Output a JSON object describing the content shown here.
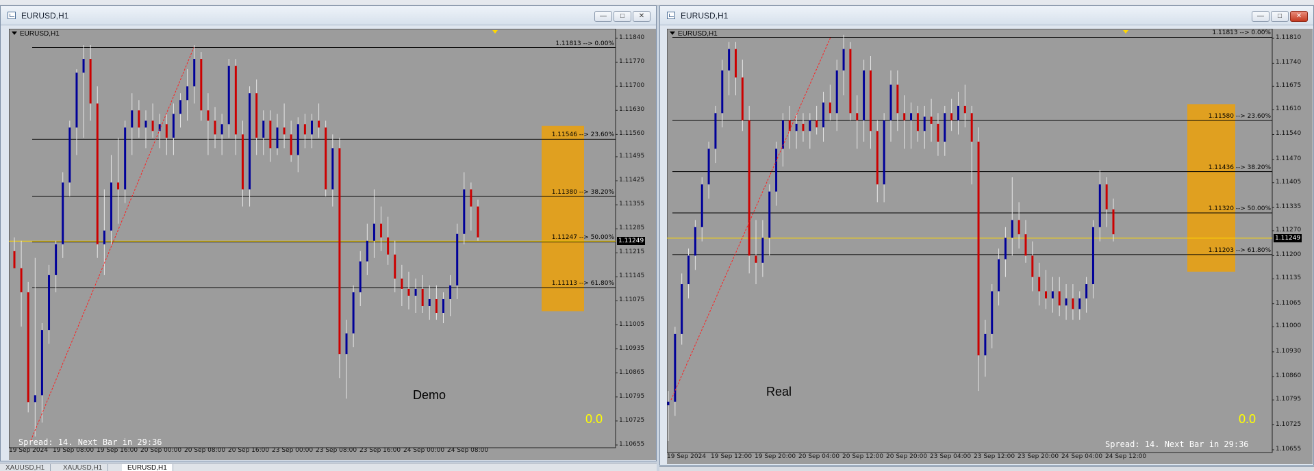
{
  "left_window": {
    "title": "EURUSD,H1",
    "chart_label": "EURUSD,H1",
    "annotation": "Demo",
    "signal_value": "0.0",
    "status": "Spread: 14. Next Bar in 29:36",
    "current_price": "1.11249",
    "y_axis": {
      "min": 1.10655,
      "max": 1.1184,
      "ticks": [
        "1.11840",
        "1.11770",
        "1.11700",
        "1.11630",
        "1.11560",
        "1.11495",
        "1.11425",
        "1.11355",
        "1.11285",
        "1.11215",
        "1.11145",
        "1.11075",
        "1.11005",
        "1.10935",
        "1.10865",
        "1.10795",
        "1.10725",
        "1.10655"
      ]
    },
    "x_axis": [
      "19 Sep 2024",
      "19 Sep 08:00",
      "19 Sep 16:00",
      "20 Sep 00:00",
      "20 Sep 08:00",
      "20 Sep 16:00",
      "23 Sep 00:00",
      "23 Sep 08:00",
      "23 Sep 16:00",
      "24 Sep 00:00",
      "24 Sep 08:00"
    ],
    "fib_levels": [
      {
        "price": 1.11813,
        "label": "1.11813 --> 0.00%"
      },
      {
        "price": 1.11546,
        "label": "1.11546 --> 23.60%"
      },
      {
        "price": 1.1138,
        "label": "1.11380 --> 38.20%"
      },
      {
        "price": 1.11247,
        "label": "1.11247 --> 50.00%"
      },
      {
        "price": 1.11113,
        "label": "1.11113 --> 61.80%"
      }
    ],
    "zone": {
      "top_price": 1.11585,
      "bottom_price": 1.11045
    },
    "trend_line": {
      "from_price": 1.10668,
      "to_price": 1.11813
    }
  },
  "right_window": {
    "title": "EURUSD,H1",
    "chart_label": "EURUSD,H1",
    "annotation": "Real",
    "signal_value": "0.0",
    "status": "Spread: 14. Next Bar in 29:36",
    "current_price": "1.11249",
    "y_axis": {
      "min": 1.10655,
      "max": 1.1181,
      "ticks": [
        "1.11810",
        "1.11740",
        "1.11675",
        "1.11610",
        "1.11540",
        "1.11470",
        "1.11405",
        "1.11335",
        "1.11270",
        "1.11200",
        "1.11135",
        "1.11065",
        "1.11000",
        "1.10930",
        "1.10860",
        "1.10795",
        "1.10725",
        "1.10655"
      ]
    },
    "x_axis": [
      "19 Sep 2024",
      "19 Sep 12:00",
      "19 Sep 20:00",
      "20 Sep 04:00",
      "20 Sep 12:00",
      "20 Sep 20:00",
      "23 Sep 04:00",
      "23 Sep 12:00",
      "23 Sep 20:00",
      "24 Sep 04:00",
      "24 Sep 12:00"
    ],
    "fib_levels": [
      {
        "price": 1.11813,
        "label": "1.11813 --> 0.00%"
      },
      {
        "price": 1.1158,
        "label": "1.11580 --> 23.60%"
      },
      {
        "price": 1.11436,
        "label": "1.11436 --> 38.20%"
      },
      {
        "price": 1.1132,
        "label": "1.11320 --> 50.00%"
      },
      {
        "price": 1.11203,
        "label": "1.11203 --> 61.80%"
      }
    ],
    "zone": {
      "top_price": 1.11625,
      "bottom_price": 1.11155
    },
    "trend_line": {
      "from_price": 1.10795,
      "to_price": 1.11813
    }
  },
  "bottom_tabs": [
    "XAUUSD,H1",
    "XAUUSD,H1",
    "EURUSD,H1"
  ],
  "colors": {
    "chart_bg": "#9c9c9c",
    "bull": "#000099",
    "bear": "#cc0000",
    "doji": "#22bb22",
    "fib_line": "#000000",
    "current_price_line": "#ffd700",
    "zone": "#e0a020",
    "signal": "#ffff00",
    "trend_line": "#ff2020"
  },
  "chart_data": [
    {
      "type": "candlestick",
      "title": "EURUSD,H1",
      "ylim": [
        1.10655,
        1.1184
      ],
      "x": [
        "19 Sep 2024",
        "19 Sep 08:00",
        "19 Sep 16:00",
        "20 Sep 00:00",
        "20 Sep 08:00",
        "20 Sep 16:00",
        "23 Sep 00:00",
        "23 Sep 08:00",
        "23 Sep 16:00",
        "24 Sep 00:00",
        "24 Sep 08:00"
      ],
      "series": [
        {
          "ohlc": [
            [
              1.1122,
              1.1126,
              1.1118,
              1.1117
            ],
            [
              1.1117,
              1.1125,
              1.11,
              1.111
            ],
            [
              1.111,
              1.1113,
              1.1075,
              1.1078
            ],
            [
              1.1078,
              1.112,
              1.1068,
              1.108
            ],
            [
              1.108,
              1.1101,
              1.1072,
              1.1099
            ],
            [
              1.1099,
              1.1118,
              1.1095,
              1.1115
            ],
            [
              1.1115,
              1.1125,
              1.111,
              1.1124
            ],
            [
              1.1124,
              1.1145,
              1.112,
              1.1142
            ],
            [
              1.1142,
              1.116,
              1.1138,
              1.1158
            ],
            [
              1.1158,
              1.1175,
              1.115,
              1.1174
            ],
            [
              1.1174,
              1.1182,
              1.1155,
              1.1178
            ],
            [
              1.1178,
              1.1182,
              1.116,
              1.1165
            ],
            [
              1.1165,
              1.117,
              1.112,
              1.1124
            ],
            [
              1.1124,
              1.114,
              1.1115,
              1.1128
            ],
            [
              1.1128,
              1.115,
              1.1124,
              1.1142
            ],
            [
              1.1142,
              1.1155,
              1.113,
              1.114
            ],
            [
              1.114,
              1.116,
              1.1136,
              1.1158
            ],
            [
              1.1158,
              1.1168,
              1.115,
              1.1163
            ],
            [
              1.1163,
              1.1166,
              1.1155,
              1.1158
            ],
            [
              1.1158,
              1.1163,
              1.1152,
              1.116
            ],
            [
              1.116,
              1.1165,
              1.1155,
              1.1157
            ],
            [
              1.1157,
              1.1162,
              1.1152,
              1.1159
            ],
            [
              1.1159,
              1.1162,
              1.115,
              1.1155
            ],
            [
              1.1155,
              1.1165,
              1.115,
              1.1162
            ],
            [
              1.1162,
              1.1168,
              1.1158,
              1.1166
            ],
            [
              1.1166,
              1.1175,
              1.116,
              1.117
            ],
            [
              1.117,
              1.1182,
              1.1165,
              1.1178
            ],
            [
              1.1178,
              1.118,
              1.116,
              1.1163
            ],
            [
              1.1163,
              1.1168,
              1.115,
              1.116
            ],
            [
              1.116,
              1.1164,
              1.1152,
              1.1156
            ],
            [
              1.1156,
              1.1162,
              1.115,
              1.1159
            ],
            [
              1.1159,
              1.1178,
              1.1155,
              1.1176
            ],
            [
              1.1176,
              1.1178,
              1.115,
              1.1156
            ],
            [
              1.1156,
              1.116,
              1.1135,
              1.114
            ],
            [
              1.114,
              1.117,
              1.1135,
              1.1168
            ],
            [
              1.1168,
              1.1172,
              1.115,
              1.1155
            ],
            [
              1.1155,
              1.1163,
              1.115,
              1.116
            ],
            [
              1.116,
              1.1163,
              1.1148,
              1.1152
            ],
            [
              1.1152,
              1.1162,
              1.115,
              1.1158
            ],
            [
              1.1158,
              1.1165,
              1.1152,
              1.1156
            ],
            [
              1.1156,
              1.116,
              1.1148,
              1.115
            ],
            [
              1.115,
              1.1161,
              1.1145,
              1.1159
            ],
            [
              1.1159,
              1.1162,
              1.1152,
              1.1156
            ],
            [
              1.1156,
              1.1162,
              1.1152,
              1.116
            ],
            [
              1.116,
              1.1165,
              1.1155,
              1.1158
            ],
            [
              1.1158,
              1.116,
              1.1138,
              1.114
            ],
            [
              1.114,
              1.1156,
              1.1135,
              1.1152
            ],
            [
              1.1152,
              1.1155,
              1.1085,
              1.1092
            ],
            [
              1.1092,
              1.1102,
              1.1079,
              1.1098
            ],
            [
              1.1098,
              1.1112,
              1.1094,
              1.111
            ],
            [
              1.111,
              1.1122,
              1.1106,
              1.1119
            ],
            [
              1.1119,
              1.113,
              1.1115,
              1.1125
            ],
            [
              1.1125,
              1.114,
              1.112,
              1.113
            ],
            [
              1.113,
              1.1135,
              1.1122,
              1.1126
            ],
            [
              1.1126,
              1.1132,
              1.1118,
              1.1121
            ],
            [
              1.1121,
              1.1125,
              1.111,
              1.1114
            ],
            [
              1.1114,
              1.1118,
              1.1106,
              1.1111
            ],
            [
              1.1111,
              1.1116,
              1.1105,
              1.1109
            ],
            [
              1.1109,
              1.1114,
              1.1104,
              1.1111
            ],
            [
              1.1111,
              1.1115,
              1.1104,
              1.1106
            ],
            [
              1.1106,
              1.1112,
              1.1102,
              1.1108
            ],
            [
              1.1108,
              1.1112,
              1.1102,
              1.1104
            ],
            [
              1.1104,
              1.111,
              1.1101,
              1.1108
            ],
            [
              1.1108,
              1.1115,
              1.1103,
              1.1112
            ],
            [
              1.1112,
              1.113,
              1.1108,
              1.1127
            ],
            [
              1.1127,
              1.1145,
              1.1124,
              1.114
            ],
            [
              1.114,
              1.1142,
              1.1128,
              1.1135
            ],
            [
              1.1135,
              1.1137,
              1.1125,
              1.1126
            ]
          ]
        }
      ]
    },
    {
      "type": "candlestick",
      "title": "EURUSD,H1",
      "ylim": [
        1.10655,
        1.1181
      ],
      "x": [
        "19 Sep 2024",
        "19 Sep 12:00",
        "19 Sep 20:00",
        "20 Sep 04:00",
        "20 Sep 12:00",
        "20 Sep 20:00",
        "23 Sep 04:00",
        "23 Sep 12:00",
        "23 Sep 20:00",
        "24 Sep 04:00",
        "24 Sep 12:00"
      ],
      "series": [
        {
          "ohlc": [
            [
              1.1078,
              1.1082,
              1.1068,
              1.1079
            ],
            [
              1.1079,
              1.11,
              1.1075,
              1.1098
            ],
            [
              1.1098,
              1.1115,
              1.1095,
              1.1112
            ],
            [
              1.1112,
              1.1122,
              1.1108,
              1.112
            ],
            [
              1.112,
              1.113,
              1.1116,
              1.1128
            ],
            [
              1.1128,
              1.1142,
              1.1124,
              1.114
            ],
            [
              1.114,
              1.1152,
              1.1136,
              1.115
            ],
            [
              1.115,
              1.1162,
              1.1146,
              1.116
            ],
            [
              1.116,
              1.1175,
              1.1156,
              1.1172
            ],
            [
              1.1172,
              1.118,
              1.1165,
              1.1178
            ],
            [
              1.1178,
              1.118,
              1.1165,
              1.117
            ],
            [
              1.117,
              1.1175,
              1.1155,
              1.1158
            ],
            [
              1.1158,
              1.1162,
              1.1115,
              1.112
            ],
            [
              1.112,
              1.113,
              1.1112,
              1.1118
            ],
            [
              1.1118,
              1.113,
              1.1114,
              1.1125
            ],
            [
              1.1125,
              1.114,
              1.112,
              1.1138
            ],
            [
              1.1138,
              1.1152,
              1.1134,
              1.115
            ],
            [
              1.115,
              1.116,
              1.1145,
              1.1158
            ],
            [
              1.1158,
              1.1162,
              1.115,
              1.1155
            ],
            [
              1.1155,
              1.116,
              1.115,
              1.1157
            ],
            [
              1.1157,
              1.116,
              1.1152,
              1.1155
            ],
            [
              1.1155,
              1.116,
              1.115,
              1.1158
            ],
            [
              1.1158,
              1.1162,
              1.1154,
              1.1156
            ],
            [
              1.1156,
              1.1166,
              1.1152,
              1.1163
            ],
            [
              1.1163,
              1.1168,
              1.1158,
              1.116
            ],
            [
              1.116,
              1.1175,
              1.1155,
              1.1172
            ],
            [
              1.1172,
              1.1182,
              1.1165,
              1.1178
            ],
            [
              1.1178,
              1.118,
              1.1158,
              1.116
            ],
            [
              1.116,
              1.1165,
              1.115,
              1.1158
            ],
            [
              1.1158,
              1.1175,
              1.1152,
              1.1172
            ],
            [
              1.1172,
              1.1176,
              1.115,
              1.1155
            ],
            [
              1.1155,
              1.1158,
              1.1135,
              1.114
            ],
            [
              1.114,
              1.116,
              1.1135,
              1.1158
            ],
            [
              1.1158,
              1.1172,
              1.1152,
              1.1168
            ],
            [
              1.1168,
              1.1172,
              1.1155,
              1.116
            ],
            [
              1.116,
              1.1165,
              1.115,
              1.1158
            ],
            [
              1.1158,
              1.1163,
              1.115,
              1.116
            ],
            [
              1.116,
              1.1162,
              1.1152,
              1.1155
            ],
            [
              1.1155,
              1.1162,
              1.115,
              1.1159
            ],
            [
              1.1159,
              1.1164,
              1.1152,
              1.1157
            ],
            [
              1.1157,
              1.116,
              1.1148,
              1.1152
            ],
            [
              1.1152,
              1.1162,
              1.1148,
              1.116
            ],
            [
              1.116,
              1.1164,
              1.1155,
              1.1158
            ],
            [
              1.1158,
              1.1166,
              1.1154,
              1.1162
            ],
            [
              1.1162,
              1.1168,
              1.1156,
              1.116
            ],
            [
              1.116,
              1.1162,
              1.114,
              1.1152
            ],
            [
              1.1152,
              1.1156,
              1.1082,
              1.1092
            ],
            [
              1.1092,
              1.1102,
              1.1086,
              1.1098
            ],
            [
              1.1098,
              1.1112,
              1.1094,
              1.111
            ],
            [
              1.111,
              1.1122,
              1.1106,
              1.1119
            ],
            [
              1.1119,
              1.1128,
              1.1114,
              1.1125
            ],
            [
              1.1125,
              1.1142,
              1.112,
              1.113
            ],
            [
              1.113,
              1.1135,
              1.1122,
              1.1126
            ],
            [
              1.1126,
              1.113,
              1.1118,
              1.112
            ],
            [
              1.112,
              1.1124,
              1.111,
              1.1114
            ],
            [
              1.1114,
              1.1118,
              1.1106,
              1.111
            ],
            [
              1.111,
              1.1116,
              1.1105,
              1.1108
            ],
            [
              1.1108,
              1.1114,
              1.1104,
              1.111
            ],
            [
              1.111,
              1.1114,
              1.1103,
              1.1106
            ],
            [
              1.1106,
              1.1112,
              1.1102,
              1.1108
            ],
            [
              1.1108,
              1.1112,
              1.1102,
              1.1105
            ],
            [
              1.1105,
              1.111,
              1.1102,
              1.1108
            ],
            [
              1.1108,
              1.1114,
              1.1104,
              1.1112
            ],
            [
              1.1112,
              1.113,
              1.1108,
              1.1128
            ],
            [
              1.1128,
              1.1144,
              1.1124,
              1.114
            ],
            [
              1.114,
              1.1142,
              1.1128,
              1.1133
            ],
            [
              1.1133,
              1.1136,
              1.1124,
              1.1126
            ]
          ]
        }
      ]
    }
  ]
}
